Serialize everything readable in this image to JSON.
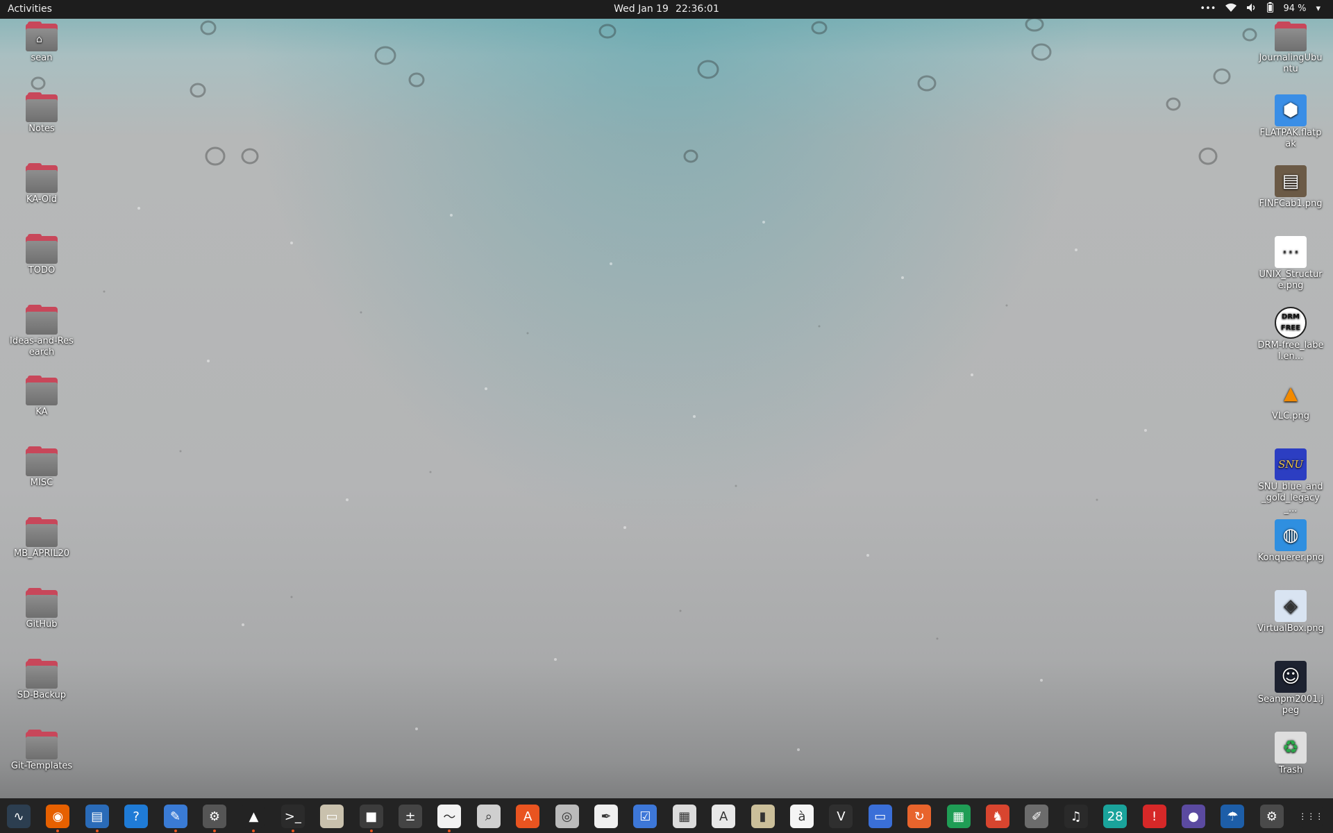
{
  "topbar": {
    "activities": "Activities",
    "date": "Wed Jan 19",
    "time": "22:36:01",
    "battery": "94 %",
    "menu_icons": [
      "overflow-dots-icon",
      "wifi-icon",
      "volume-icon",
      "battery-icon",
      "system-menu-chevron-icon"
    ]
  },
  "desktop": {
    "left_icons": [
      {
        "label": "sean",
        "kind": "home-folder"
      },
      {
        "label": "Notes",
        "kind": "folder"
      },
      {
        "label": "KA-Old",
        "kind": "folder"
      },
      {
        "label": "TODO",
        "kind": "folder"
      },
      {
        "label": "Ideas-and-Research",
        "kind": "folder"
      },
      {
        "label": "KA",
        "kind": "folder"
      },
      {
        "label": "MISC",
        "kind": "folder"
      },
      {
        "label": "MB_APRIL20",
        "kind": "folder"
      },
      {
        "label": "GitHub",
        "kind": "folder"
      },
      {
        "label": "SD-Backup",
        "kind": "folder"
      },
      {
        "label": "Git-Templates",
        "kind": "folder"
      }
    ],
    "right_icons": [
      {
        "label": "JournalingUbuntu",
        "kind": "folder"
      },
      {
        "label": "FLATPAK.flatpak",
        "kind": "flatpak-file"
      },
      {
        "label": "FINFCab1.png",
        "kind": "image"
      },
      {
        "label": "UNIX_Structure.png",
        "kind": "image"
      },
      {
        "label": "DRM-free_label.en...",
        "kind": "image"
      },
      {
        "label": "VLC.png",
        "kind": "image"
      },
      {
        "label": "SNU_blue_and_gold_legacy_...",
        "kind": "image"
      },
      {
        "label": "Konquerer.png",
        "kind": "image"
      },
      {
        "label": "VirtualBox.png",
        "kind": "image"
      },
      {
        "label": "Seanpm2001.jpeg",
        "kind": "image"
      },
      {
        "label": "Trash",
        "kind": "trash"
      }
    ],
    "thumb_texts": {
      "drm": "DRM FREE",
      "snu": "SNU",
      "calendar": "28"
    }
  },
  "dock": {
    "items": [
      {
        "name": "system-monitor-icon",
        "color": "#2c3e50",
        "glyph": "∿",
        "running": false
      },
      {
        "name": "firefox-icon",
        "color": "#e66000",
        "glyph": "◉",
        "running": true
      },
      {
        "name": "libreoffice-writer-icon",
        "color": "#2a6bb8",
        "glyph": "▤",
        "running": true
      },
      {
        "name": "help-icon",
        "color": "#1f7bd6",
        "glyph": "?",
        "running": false
      },
      {
        "name": "text-editor-icon",
        "color": "#3a7bd5",
        "glyph": "✎",
        "running": true
      },
      {
        "name": "settings-icon",
        "color": "#555555",
        "glyph": "⚙",
        "running": true
      },
      {
        "name": "vlc-icon",
        "color": "#232323",
        "glyph": "▲",
        "running": true
      },
      {
        "name": "terminal-icon",
        "color": "#2b2b2b",
        "glyph": ">_",
        "running": true
      },
      {
        "name": "files-icon",
        "color": "#c9c1ad",
        "glyph": "▭",
        "running": false
      },
      {
        "name": "gnome-boxes-icon",
        "color": "#3c3c3c",
        "glyph": "■",
        "running": true
      },
      {
        "name": "calculator-icon",
        "color": "#444444",
        "glyph": "±",
        "running": false
      },
      {
        "name": "gnuplot-icon",
        "color": "#f2f2f2",
        "glyph": "〜",
        "running": true
      },
      {
        "name": "image-viewer-icon",
        "color": "#cfcfcf",
        "glyph": "⌕",
        "running": false
      },
      {
        "name": "software-center-icon",
        "color": "#e95420",
        "glyph": "A",
        "running": false
      },
      {
        "name": "disk-utility-icon",
        "color": "#bbbbbb",
        "glyph": "◎",
        "running": false
      },
      {
        "name": "inkscape-icon",
        "color": "#f0f0f0",
        "glyph": "✒",
        "running": false
      },
      {
        "name": "todo-icon",
        "color": "#3d77d8",
        "glyph": "☑",
        "running": false
      },
      {
        "name": "screenshot-icon",
        "color": "#dcdcdc",
        "glyph": "▦",
        "running": false
      },
      {
        "name": "document-viewer-icon",
        "color": "#e8e8e8",
        "glyph": "A",
        "running": false
      },
      {
        "name": "archive-manager-icon",
        "color": "#cbbf9a",
        "glyph": "▮",
        "running": false
      },
      {
        "name": "character-map-icon",
        "color": "#f5f5f5",
        "glyph": "à",
        "running": false
      },
      {
        "name": "vim-icon",
        "color": "#2f2f2f",
        "glyph": "V",
        "running": false
      },
      {
        "name": "remote-desktop-icon",
        "color": "#3a6fd8",
        "glyph": "▭",
        "running": false
      },
      {
        "name": "timeshift-icon",
        "color": "#e8642c",
        "glyph": "↻",
        "running": false
      },
      {
        "name": "spreadsheet-icon",
        "color": "#1f9d55",
        "glyph": "▦",
        "running": false
      },
      {
        "name": "game-icon",
        "color": "#d8452f",
        "glyph": "♞",
        "running": false
      },
      {
        "name": "gimp-icon",
        "color": "#6c6c6c",
        "glyph": "✐",
        "running": false
      },
      {
        "name": "music-icon",
        "color": "#2a2a2a",
        "glyph": "♫",
        "running": false
      },
      {
        "name": "calendar-icon",
        "color": "#1aa39b",
        "glyph": "28",
        "running": false
      },
      {
        "name": "error-reporter-icon",
        "color": "#d62828",
        "glyph": "!",
        "running": false
      },
      {
        "name": "obs-icon",
        "color": "#5b4aa0",
        "glyph": "●",
        "running": false
      },
      {
        "name": "weather-icon",
        "color": "#1d5ea8",
        "glyph": "☂",
        "running": false
      },
      {
        "name": "updater-icon",
        "color": "#4a4a4a",
        "glyph": "⚙",
        "running": false
      },
      {
        "name": "show-apps-icon",
        "color": "#232323",
        "glyph": "⋮⋮⋮",
        "running": false
      }
    ]
  }
}
